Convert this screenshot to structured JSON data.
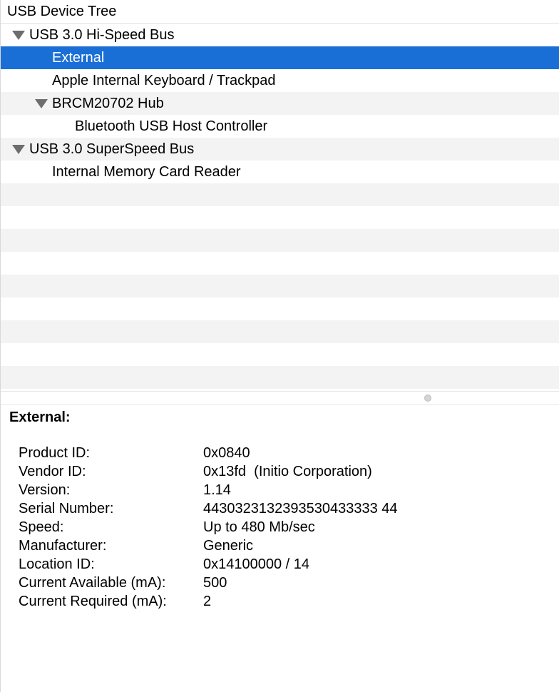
{
  "tree": {
    "header": "USB Device Tree",
    "rows": [
      {
        "label": "USB 3.0 Hi-Speed Bus",
        "level": 0,
        "expanded": true,
        "selected": false
      },
      {
        "label": "External",
        "level": 1,
        "expanded": null,
        "selected": true
      },
      {
        "label": "Apple Internal Keyboard / Trackpad",
        "level": 1,
        "expanded": null,
        "selected": false
      },
      {
        "label": "BRCM20702 Hub",
        "level": 1,
        "expanded": true,
        "selected": false
      },
      {
        "label": "Bluetooth USB Host Controller",
        "level": 2,
        "expanded": null,
        "selected": false
      },
      {
        "label": "USB 3.0 SuperSpeed Bus",
        "level": 0,
        "expanded": true,
        "selected": false
      },
      {
        "label": "Internal Memory Card Reader",
        "level": 1,
        "expanded": null,
        "selected": false
      },
      {
        "label": "",
        "level": 0,
        "expanded": null,
        "selected": false
      },
      {
        "label": "",
        "level": 0,
        "expanded": null,
        "selected": false
      },
      {
        "label": "",
        "level": 0,
        "expanded": null,
        "selected": false
      },
      {
        "label": "",
        "level": 0,
        "expanded": null,
        "selected": false
      },
      {
        "label": "",
        "level": 0,
        "expanded": null,
        "selected": false
      },
      {
        "label": "",
        "level": 0,
        "expanded": null,
        "selected": false
      },
      {
        "label": "",
        "level": 0,
        "expanded": null,
        "selected": false
      },
      {
        "label": "",
        "level": 0,
        "expanded": null,
        "selected": false
      },
      {
        "label": "",
        "level": 0,
        "expanded": null,
        "selected": false
      },
      {
        "label": "",
        "level": 0,
        "expanded": null,
        "selected": false
      }
    ]
  },
  "detail": {
    "title": "External:",
    "properties": [
      {
        "key": "Product ID:",
        "value": "0x0840"
      },
      {
        "key": "Vendor ID:",
        "value": "0x13fd  (Initio Corporation)"
      },
      {
        "key": "Version:",
        "value": "1.14"
      },
      {
        "key": "Serial Number:",
        "value": "4430323132393530433333 44"
      },
      {
        "key": "Speed:",
        "value": "Up to 480 Mb/sec"
      },
      {
        "key": "Manufacturer:",
        "value": "Generic"
      },
      {
        "key": "Location ID:",
        "value": "0x14100000 / 14"
      },
      {
        "key": "Current Available (mA):",
        "value": "500"
      },
      {
        "key": "Current Required (mA):",
        "value": "2"
      }
    ]
  },
  "colors": {
    "selection": "#1a6fd6",
    "stripe": "#f3f3f3",
    "disclosure": "#6d6d6d"
  },
  "icons": {
    "disclosure": "disclosure-triangle-icon",
    "splitter": "split-handle-icon"
  }
}
